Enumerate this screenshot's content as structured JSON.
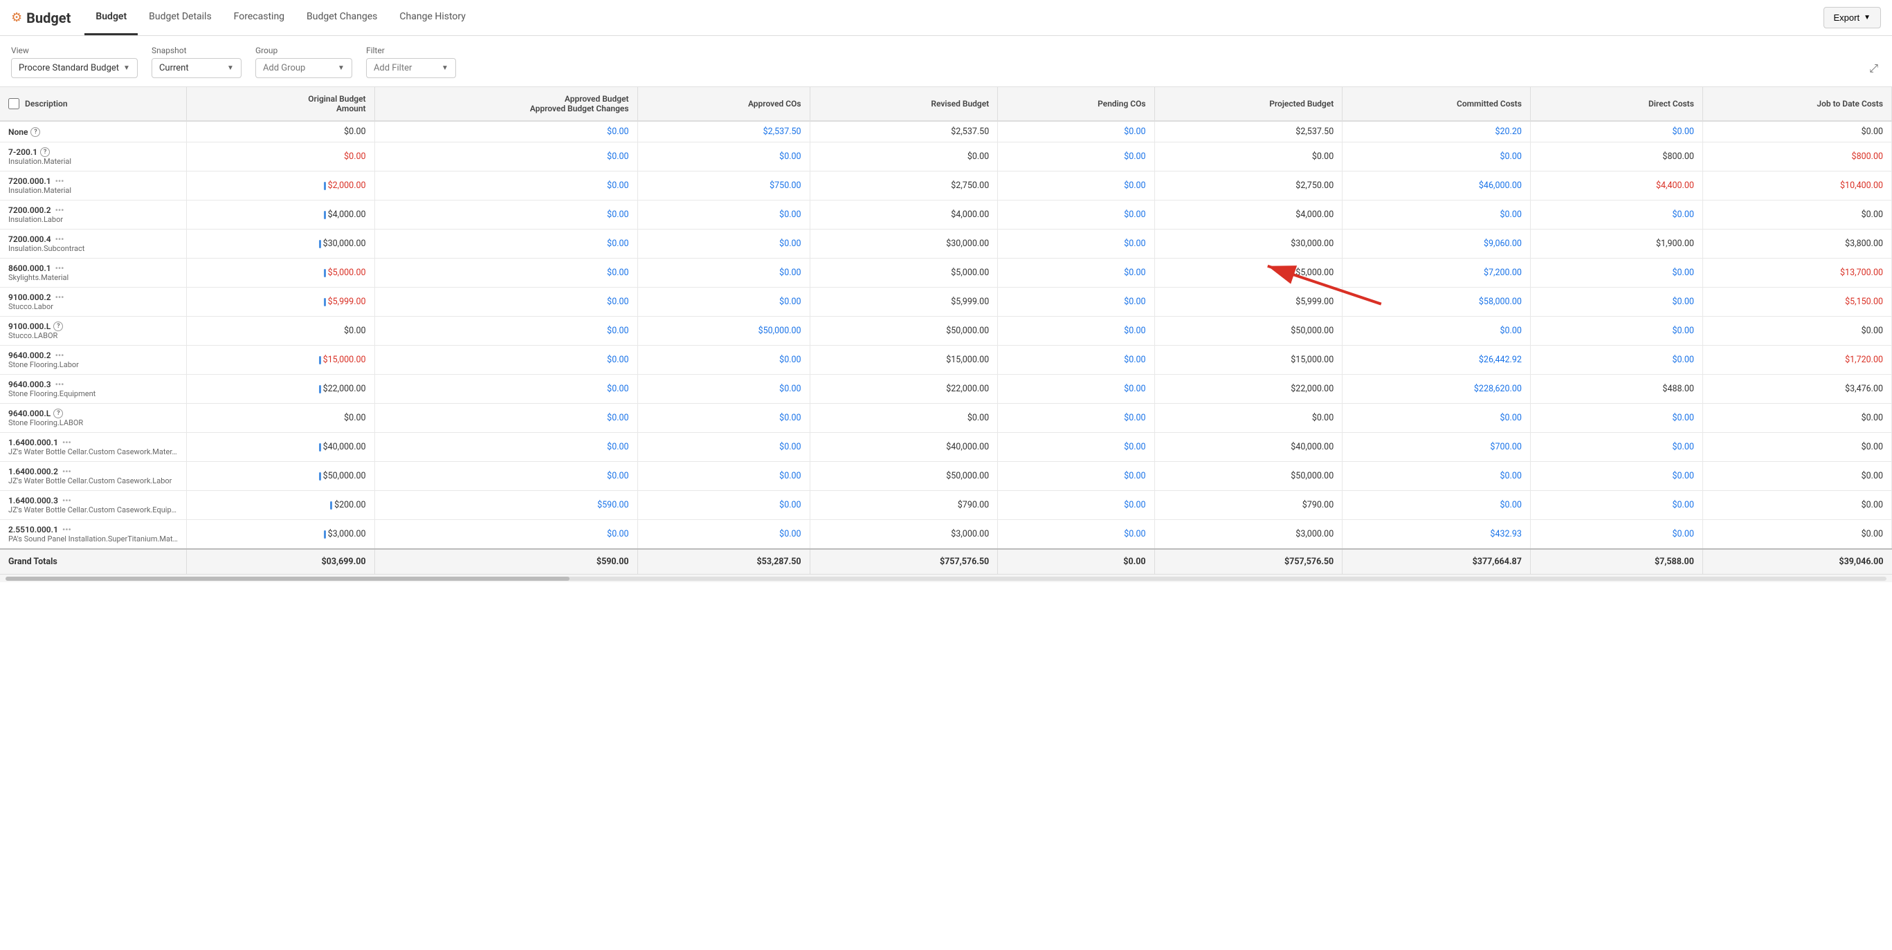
{
  "app": {
    "title": "Budget",
    "logo_icon": "⚙"
  },
  "nav": {
    "tabs": [
      {
        "label": "Budget",
        "active": true
      },
      {
        "label": "Budget Details",
        "active": false
      },
      {
        "label": "Forecasting",
        "active": false
      },
      {
        "label": "Budget Changes",
        "active": false
      },
      {
        "label": "Change History",
        "active": false
      }
    ],
    "export_label": "Export"
  },
  "filters": {
    "view_label": "View",
    "view_value": "Procore Standard Budget",
    "snapshot_label": "Snapshot",
    "snapshot_value": "Current",
    "group_label": "Group",
    "group_value": "Add Group",
    "filter_label": "Filter",
    "filter_value": "Add Filter"
  },
  "table": {
    "columns": [
      "Description",
      "Original Budget Amount",
      "Approved Budget Changes",
      "Approved COs",
      "Revised Budget",
      "Pending COs",
      "Projected Budget",
      "Committed Costs",
      "Direct Costs",
      "Job to Date Costs"
    ],
    "rows": [
      {
        "code": "None",
        "subcode": "",
        "has_help": true,
        "original": "$0.00",
        "original_color": "black",
        "approved_changes": "$0.00",
        "approved_changes_color": "blue",
        "approved_cos": "$2,537.50",
        "approved_cos_color": "blue",
        "revised": "$2,537.50",
        "revised_color": "black",
        "pending_cos": "$0.00",
        "pending_cos_color": "blue",
        "projected": "$2,537.50",
        "projected_color": "black",
        "committed": "$20.20",
        "committed_color": "blue",
        "direct": "$0.00",
        "direct_color": "blue",
        "jtd": "$0.00",
        "jtd_color": "black"
      },
      {
        "code": "7-200.1",
        "subcode": "Insulation.Material",
        "has_help": true,
        "original": "$0.00",
        "original_color": "red",
        "approved_changes": "$0.00",
        "approved_changes_color": "blue",
        "approved_cos": "$0.00",
        "approved_cos_color": "blue",
        "revised": "$0.00",
        "revised_color": "black",
        "pending_cos": "$0.00",
        "pending_cos_color": "blue",
        "projected": "$0.00",
        "projected_color": "black",
        "committed": "$0.00",
        "committed_color": "blue",
        "direct": "$800.00",
        "direct_color": "black",
        "jtd": "$800.00",
        "jtd_color": "red",
        "has_arrow": true
      },
      {
        "code": "7200.000.1",
        "subcode": "Insulation.Material",
        "has_help": false,
        "has_dots": true,
        "has_drag": true,
        "original": "$2,000.00",
        "original_color": "red",
        "approved_changes": "$0.00",
        "approved_changes_color": "blue",
        "approved_cos": "$750.00",
        "approved_cos_color": "blue",
        "revised": "$2,750.00",
        "revised_color": "black",
        "pending_cos": "$0.00",
        "pending_cos_color": "blue",
        "projected": "$2,750.00",
        "projected_color": "black",
        "committed": "$46,000.00",
        "committed_color": "blue",
        "direct": "$4,400.00",
        "direct_color": "red",
        "jtd": "$10,400.00",
        "jtd_color": "red"
      },
      {
        "code": "7200.000.2",
        "subcode": "Insulation.Labor",
        "has_help": false,
        "has_dots": true,
        "has_drag": true,
        "original": "$4,000.00",
        "original_color": "black",
        "approved_changes": "$0.00",
        "approved_changes_color": "blue",
        "approved_cos": "$0.00",
        "approved_cos_color": "blue",
        "revised": "$4,000.00",
        "revised_color": "black",
        "pending_cos": "$0.00",
        "pending_cos_color": "blue",
        "projected": "$4,000.00",
        "projected_color": "black",
        "committed": "$0.00",
        "committed_color": "blue",
        "direct": "$0.00",
        "direct_color": "blue",
        "jtd": "$0.00",
        "jtd_color": "black"
      },
      {
        "code": "7200.000.4",
        "subcode": "Insulation.Subcontract",
        "has_help": false,
        "has_dots": true,
        "has_drag": true,
        "original": "$30,000.00",
        "original_color": "black",
        "approved_changes": "$0.00",
        "approved_changes_color": "blue",
        "approved_cos": "$0.00",
        "approved_cos_color": "blue",
        "revised": "$30,000.00",
        "revised_color": "black",
        "pending_cos": "$0.00",
        "pending_cos_color": "blue",
        "projected": "$30,000.00",
        "projected_color": "black",
        "committed": "$9,060.00",
        "committed_color": "blue",
        "direct": "$1,900.00",
        "direct_color": "black",
        "jtd": "$3,800.00",
        "jtd_color": "black"
      },
      {
        "code": "8600.000.1",
        "subcode": "Skylights.Material",
        "has_help": false,
        "has_dots": true,
        "has_drag": true,
        "original": "$5,000.00",
        "original_color": "red",
        "approved_changes": "$0.00",
        "approved_changes_color": "blue",
        "approved_cos": "$0.00",
        "approved_cos_color": "blue",
        "revised": "$5,000.00",
        "revised_color": "black",
        "pending_cos": "$0.00",
        "pending_cos_color": "blue",
        "projected": "$5,000.00",
        "projected_color": "black",
        "committed": "$7,200.00",
        "committed_color": "blue",
        "direct": "$0.00",
        "direct_color": "blue",
        "jtd": "$13,700.00",
        "jtd_color": "red"
      },
      {
        "code": "9100.000.2",
        "subcode": "Stucco.Labor",
        "has_help": false,
        "has_dots": true,
        "has_drag": true,
        "original": "$5,999.00",
        "original_color": "red",
        "approved_changes": "$0.00",
        "approved_changes_color": "blue",
        "approved_cos": "$0.00",
        "approved_cos_color": "blue",
        "revised": "$5,999.00",
        "revised_color": "black",
        "pending_cos": "$0.00",
        "pending_cos_color": "blue",
        "projected": "$5,999.00",
        "projected_color": "black",
        "committed": "$58,000.00",
        "committed_color": "blue",
        "direct": "$0.00",
        "direct_color": "blue",
        "jtd": "$5,150.00",
        "jtd_color": "red"
      },
      {
        "code": "9100.000.L",
        "subcode": "Stucco.LABOR",
        "has_help": true,
        "original": "$0.00",
        "original_color": "black",
        "approved_changes": "$0.00",
        "approved_changes_color": "blue",
        "approved_cos": "$50,000.00",
        "approved_cos_color": "blue",
        "revised": "$50,000.00",
        "revised_color": "black",
        "pending_cos": "$0.00",
        "pending_cos_color": "blue",
        "projected": "$50,000.00",
        "projected_color": "black",
        "committed": "$0.00",
        "committed_color": "blue",
        "direct": "$0.00",
        "direct_color": "blue",
        "jtd": "$0.00",
        "jtd_color": "black"
      },
      {
        "code": "9640.000.2",
        "subcode": "Stone Flooring.Labor",
        "has_help": false,
        "has_dots": true,
        "has_drag": true,
        "original": "$15,000.00",
        "original_color": "red",
        "approved_changes": "$0.00",
        "approved_changes_color": "blue",
        "approved_cos": "$0.00",
        "approved_cos_color": "blue",
        "revised": "$15,000.00",
        "revised_color": "black",
        "pending_cos": "$0.00",
        "pending_cos_color": "blue",
        "projected": "$15,000.00",
        "projected_color": "black",
        "committed": "$26,442.92",
        "committed_color": "blue",
        "direct": "$0.00",
        "direct_color": "blue",
        "jtd": "$1,720.00",
        "jtd_color": "red"
      },
      {
        "code": "9640.000.3",
        "subcode": "Stone Flooring.Equipment",
        "has_help": false,
        "has_dots": true,
        "has_drag": true,
        "original": "$22,000.00",
        "original_color": "black",
        "approved_changes": "$0.00",
        "approved_changes_color": "blue",
        "approved_cos": "$0.00",
        "approved_cos_color": "blue",
        "revised": "$22,000.00",
        "revised_color": "black",
        "pending_cos": "$0.00",
        "pending_cos_color": "blue",
        "projected": "$22,000.00",
        "projected_color": "black",
        "committed": "$228,620.00",
        "committed_color": "blue",
        "direct": "$488.00",
        "direct_color": "black",
        "jtd": "$3,476.00",
        "jtd_color": "black"
      },
      {
        "code": "9640.000.L",
        "subcode": "Stone Flooring.LABOR",
        "has_help": true,
        "original": "$0.00",
        "original_color": "black",
        "approved_changes": "$0.00",
        "approved_changes_color": "blue",
        "approved_cos": "$0.00",
        "approved_cos_color": "blue",
        "revised": "$0.00",
        "revised_color": "black",
        "pending_cos": "$0.00",
        "pending_cos_color": "blue",
        "projected": "$0.00",
        "projected_color": "black",
        "committed": "$0.00",
        "committed_color": "blue",
        "direct": "$0.00",
        "direct_color": "blue",
        "jtd": "$0.00",
        "jtd_color": "black"
      },
      {
        "code": "1.6400.000.1",
        "subcode": "JZ's Water Bottle Cellar.Custom Casework.Mater…",
        "has_help": false,
        "has_dots": true,
        "has_drag": true,
        "original": "$40,000.00",
        "original_color": "black",
        "approved_changes": "$0.00",
        "approved_changes_color": "blue",
        "approved_cos": "$0.00",
        "approved_cos_color": "blue",
        "revised": "$40,000.00",
        "revised_color": "black",
        "pending_cos": "$0.00",
        "pending_cos_color": "blue",
        "projected": "$40,000.00",
        "projected_color": "black",
        "committed": "$700.00",
        "committed_color": "blue",
        "direct": "$0.00",
        "direct_color": "blue",
        "jtd": "$0.00",
        "jtd_color": "black"
      },
      {
        "code": "1.6400.000.2",
        "subcode": "JZ's Water Bottle Cellar.Custom Casework.Labor",
        "has_help": false,
        "has_dots": true,
        "has_drag": true,
        "original": "$50,000.00",
        "original_color": "black",
        "approved_changes": "$0.00",
        "approved_changes_color": "blue",
        "approved_cos": "$0.00",
        "approved_cos_color": "blue",
        "revised": "$50,000.00",
        "revised_color": "black",
        "pending_cos": "$0.00",
        "pending_cos_color": "blue",
        "projected": "$50,000.00",
        "projected_color": "black",
        "committed": "$0.00",
        "committed_color": "blue",
        "direct": "$0.00",
        "direct_color": "blue",
        "jtd": "$0.00",
        "jtd_color": "black"
      },
      {
        "code": "1.6400.000.3",
        "subcode": "JZ's Water Bottle Cellar.Custom Casework.Equip…",
        "has_help": false,
        "has_dots": true,
        "has_drag": true,
        "original": "$200.00",
        "original_color": "black",
        "approved_changes": "$590.00",
        "approved_changes_color": "blue",
        "approved_cos": "$0.00",
        "approved_cos_color": "blue",
        "revised": "$790.00",
        "revised_color": "black",
        "pending_cos": "$0.00",
        "pending_cos_color": "blue",
        "projected": "$790.00",
        "projected_color": "black",
        "committed": "$0.00",
        "committed_color": "blue",
        "direct": "$0.00",
        "direct_color": "blue",
        "jtd": "$0.00",
        "jtd_color": "black"
      },
      {
        "code": "2.5510.000.1",
        "subcode": "PA's Sound Panel Installation.SuperTitanium.Mat…",
        "has_help": false,
        "has_dots": true,
        "has_drag": true,
        "original": "$3,000.00",
        "original_color": "black",
        "approved_changes": "$0.00",
        "approved_changes_color": "blue",
        "approved_cos": "$0.00",
        "approved_cos_color": "blue",
        "revised": "$3,000.00",
        "revised_color": "black",
        "pending_cos": "$0.00",
        "pending_cos_color": "blue",
        "projected": "$3,000.00",
        "projected_color": "black",
        "committed": "$432.93",
        "committed_color": "blue",
        "direct": "$0.00",
        "direct_color": "blue",
        "jtd": "$0.00",
        "jtd_color": "black"
      }
    ],
    "grand_totals": {
      "label": "Grand Totals",
      "original": "$03,699.00",
      "approved_changes": "$590.00",
      "approved_cos": "$53,287.50",
      "revised": "$757,576.50",
      "pending_cos": "$0.00",
      "projected": "$757,576.50",
      "committed": "$377,664.87",
      "direct": "$7,588.00",
      "jtd": "$39,046.00"
    }
  }
}
